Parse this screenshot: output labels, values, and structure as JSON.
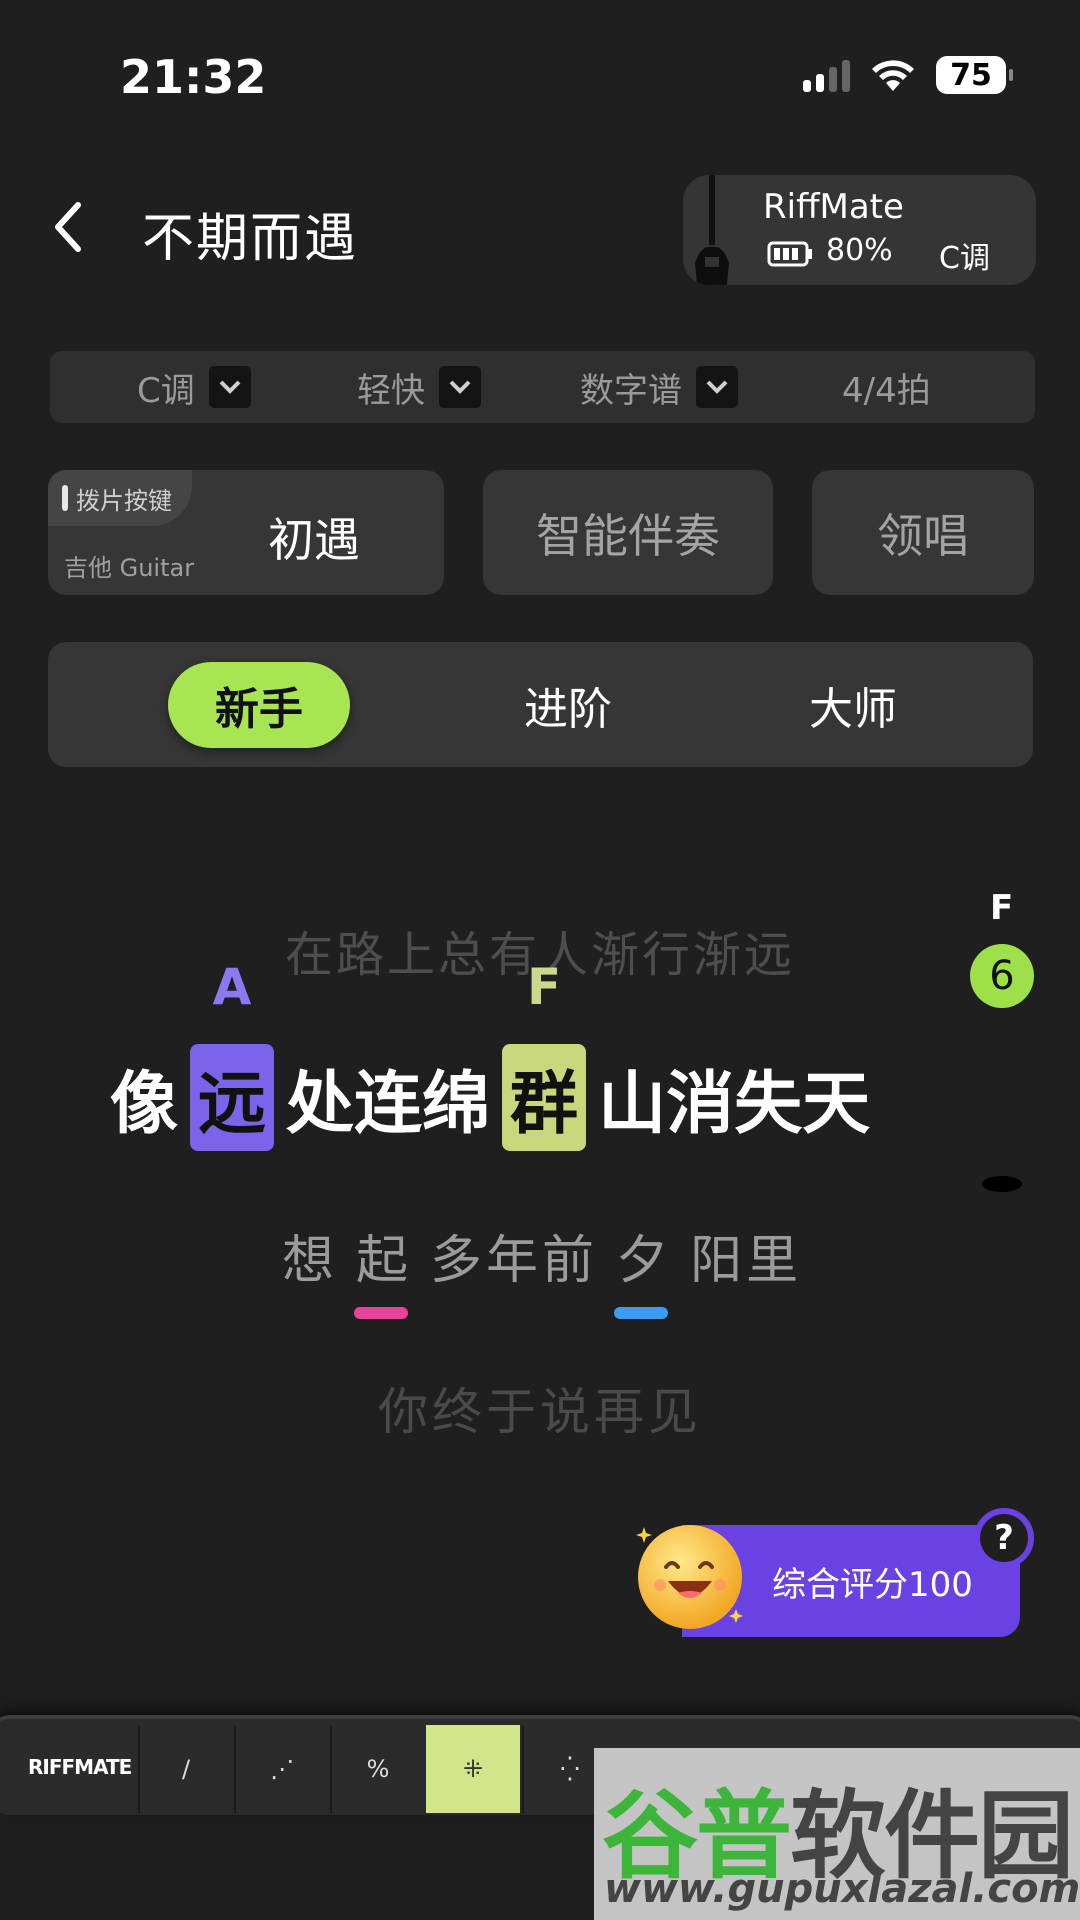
{
  "status_bar": {
    "time": "21:32",
    "battery": "75"
  },
  "header": {
    "title": "不期而遇",
    "device": {
      "name": "RiffMate",
      "battery": "80%",
      "key": "C调"
    }
  },
  "settings": {
    "key": "C调",
    "style": "轻快",
    "notation": "数字谱",
    "time_signature": "4/4拍"
  },
  "modes": {
    "pick_badge": "拨片按键",
    "instrument": "吉他 Guitar",
    "song_mode": "初遇",
    "accompaniment": "智能伴奏",
    "lead_vocal": "领唱"
  },
  "difficulty": {
    "tabs": [
      "新手",
      "进阶",
      "大师"
    ],
    "active": "新手"
  },
  "lyrics": {
    "previous": "在路上总有人渐行渐远",
    "current": {
      "part1": "像",
      "chord1": "A",
      "hl1": "远",
      "part2": "处连绵",
      "chord2": "F",
      "hl2": "群",
      "part3": "山消失天"
    },
    "next": {
      "p1": "想",
      "u1": "起",
      "p2": "多年前",
      "u2": "夕",
      "p3": "阳里"
    },
    "last": "你终于说再见"
  },
  "side_chord": {
    "name": "F",
    "fret": "6"
  },
  "score": {
    "label": "综合评分100",
    "help": "?"
  },
  "effect_bar": {
    "brand": "RIFFMATE",
    "active_index": 3
  },
  "watermark": {
    "title_a": "谷普",
    "title_b": "软件园",
    "url": "www.gupuxlazal.com"
  },
  "colors": {
    "accent_green": "#a8e552",
    "chord_a": "#7b63ea",
    "chord_f": "#c8d77c",
    "score_purple": "#6a42e3",
    "underline_pink": "#e8439a",
    "underline_blue": "#3a9cf2"
  }
}
